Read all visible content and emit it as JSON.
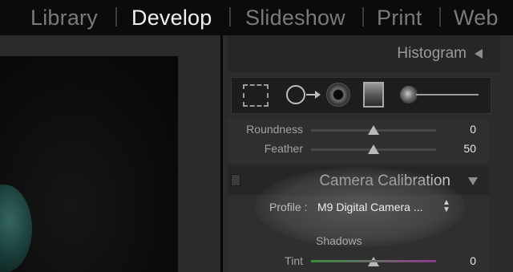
{
  "modules": {
    "library": "Library",
    "develop": "Develop",
    "slideshow": "Slideshow",
    "print": "Print",
    "web": "Web",
    "active": "develop"
  },
  "panel": {
    "histogram_title": "Histogram",
    "tools": [
      "crop-overlay-icon",
      "spot-removal-icon",
      "red-eye-icon",
      "graduated-filter-icon",
      "adjustment-brush-icon"
    ],
    "roundness": {
      "label": "Roundness",
      "value": "0",
      "fraction": 0.5
    },
    "feather": {
      "label": "Feather",
      "value": "50",
      "fraction": 0.5
    },
    "camera_calibration": {
      "title": "Camera Calibration",
      "profile_label": "Profile :",
      "profile_value": "M9 Digital Camera ...",
      "shadows_heading": "Shadows",
      "tint": {
        "label": "Tint",
        "value": "0",
        "fraction": 0.5
      }
    }
  },
  "colors": {
    "background": "#141414",
    "panel": "#2b2b2b",
    "active_module": "#f2f2f2",
    "inactive_module": "#7a7a7a"
  }
}
